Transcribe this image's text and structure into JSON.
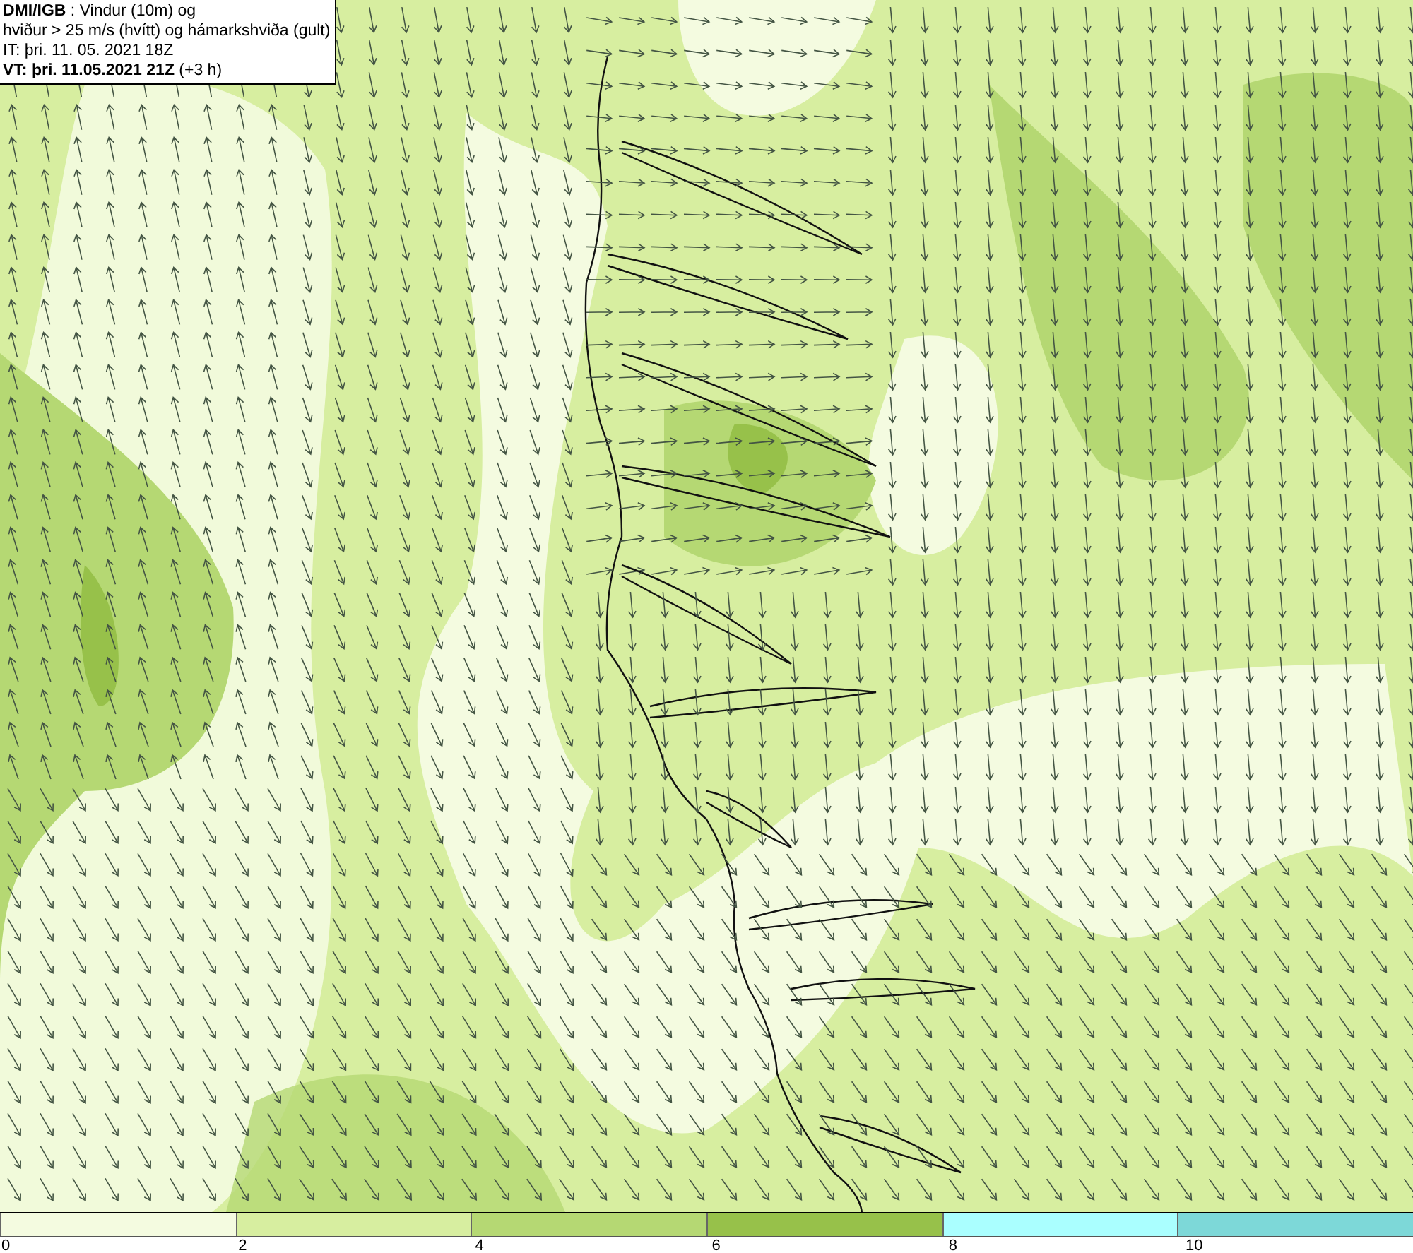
{
  "title_box": {
    "lines": [
      "**DMI/IGB** : Vindur (10m) og",
      "hviður > 25 m/s (hvítt) og hámarkshviða (gult)",
      "IT: þri. 11. 05. 2021 18Z",
      "**VT: þri. 11.05.2021 21Z** (+3 h)"
    ]
  },
  "colorbar": {
    "segments": [
      {
        "color": "#f4fbe0"
      },
      {
        "color": "#d7eea0"
      },
      {
        "color": "#b5d873"
      },
      {
        "color": "#97c14a"
      },
      {
        "color": "#aaffff"
      },
      {
        "color": "#7dd8d8"
      }
    ],
    "ticks": [
      "0",
      "2",
      "4",
      "6",
      "8",
      "10"
    ]
  }
}
